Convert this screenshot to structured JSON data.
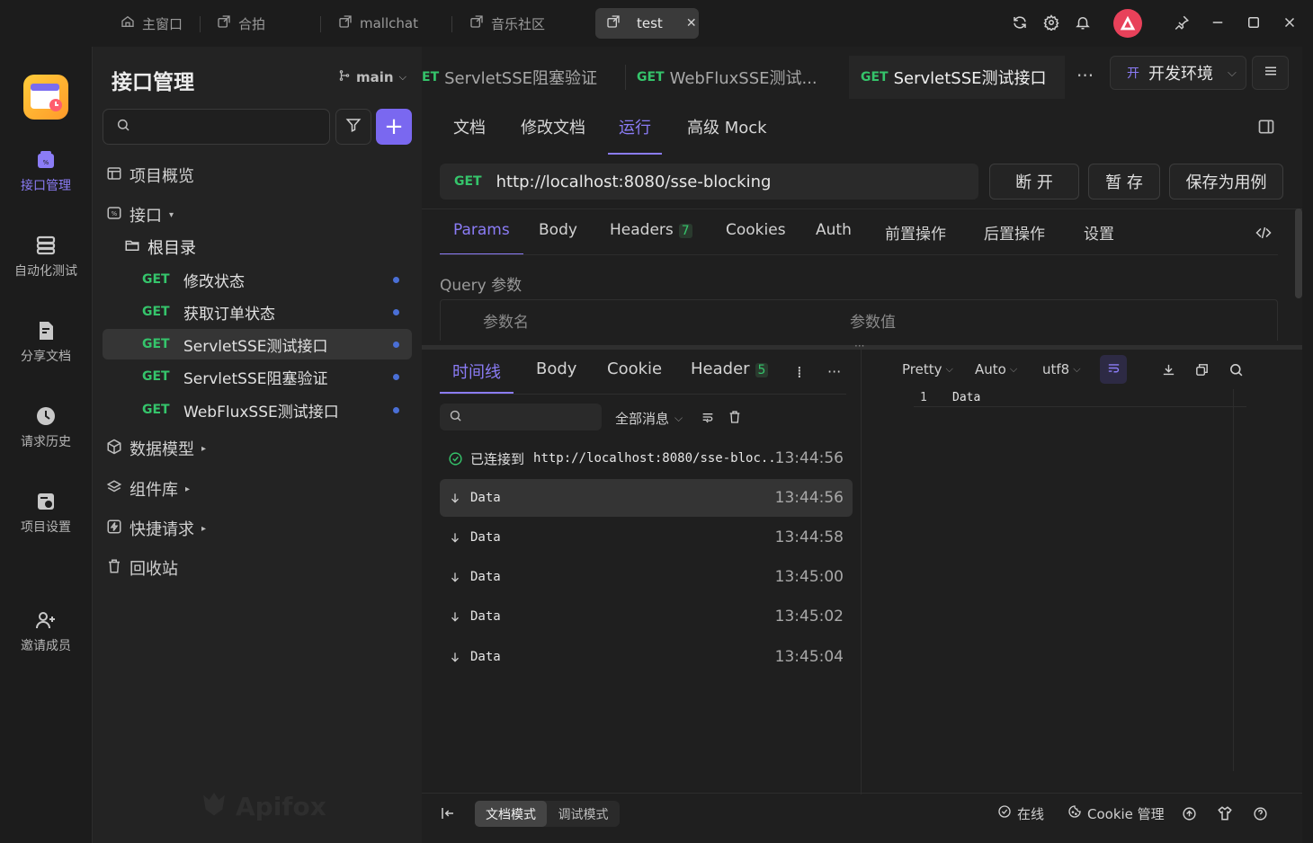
{
  "window_tabs": [
    {
      "label": "主窗口",
      "icon": "home-icon"
    },
    {
      "label": "合拍",
      "icon": "external-window-icon"
    },
    {
      "label": "mallchat",
      "icon": "external-window-icon"
    },
    {
      "label": "音乐社区",
      "icon": "external-window-icon"
    },
    {
      "label": "test",
      "icon": "external-window-icon",
      "active": true
    }
  ],
  "titlebar_icons": [
    "refresh-icon",
    "settings-icon",
    "bell-icon",
    "avatar",
    "pin-icon",
    "minimize-icon",
    "maximize-icon",
    "close-icon"
  ],
  "nav": [
    {
      "label": "接口管理",
      "icon": "api-management-icon",
      "active": true
    },
    {
      "label": "自动化测试",
      "icon": "automation-icon"
    },
    {
      "label": "分享文档",
      "icon": "share-doc-icon"
    },
    {
      "label": "请求历史",
      "icon": "history-icon"
    },
    {
      "label": "项目设置",
      "icon": "project-settings-icon"
    },
    {
      "label": "邀请成员",
      "icon": "invite-member-icon"
    }
  ],
  "sidebar": {
    "title": "接口管理",
    "branch": "main",
    "search_placeholder": "",
    "overview": "项目概览",
    "api_group": "接口",
    "root": "根目录",
    "apis": [
      {
        "method": "GET",
        "name": "修改状态"
      },
      {
        "method": "GET",
        "name": "获取订单状态"
      },
      {
        "method": "GET",
        "name": "ServletSSE测试接口",
        "selected": true
      },
      {
        "method": "GET",
        "name": "ServletSSE阻塞验证"
      },
      {
        "method": "GET",
        "name": "WebFluxSSE测试接口"
      }
    ],
    "sections": [
      {
        "label": "数据模型",
        "icon": "cube-icon"
      },
      {
        "label": "组件库",
        "icon": "layers-icon"
      },
      {
        "label": "快捷请求",
        "icon": "lightning-icon"
      },
      {
        "label": "回收站",
        "icon": "trash-icon"
      }
    ],
    "watermark": "Apifox"
  },
  "editor_tabs": [
    {
      "method": "GET",
      "name": "ServletSSE阻塞验证",
      "method_text": "ET"
    },
    {
      "method": "GET",
      "name": "WebFluxSSE测试..."
    },
    {
      "method": "GET",
      "name": "ServletSSE测试接口",
      "active": true
    }
  ],
  "env": {
    "badge": "开",
    "label": "开发环境"
  },
  "subtabs": [
    "文档",
    "修改文档",
    "运行",
    "高级 Mock"
  ],
  "active_subtab": "运行",
  "request": {
    "method": "GET",
    "url": "http://localhost:8080/sse-blocking"
  },
  "buttons": {
    "disconnect": "断 开",
    "save_temp": "暂 存",
    "save_case": "保存为用例"
  },
  "param_tabs": [
    {
      "label": "Params",
      "active": true
    },
    {
      "label": "Body"
    },
    {
      "label": "Headers",
      "count": "7"
    },
    {
      "label": "Cookies"
    },
    {
      "label": "Auth"
    },
    {
      "label": "前置操作"
    },
    {
      "label": "后置操作"
    },
    {
      "label": "设置"
    }
  ],
  "query": {
    "title": "Query 参数",
    "col_name": "参数名",
    "col_value": "参数值"
  },
  "response_tabs": [
    {
      "label": "时间线",
      "active": true
    },
    {
      "label": "Body"
    },
    {
      "label": "Cookie"
    },
    {
      "label": "Header",
      "count": "5"
    }
  ],
  "filter": {
    "all_messages": "全部消息"
  },
  "timeline": {
    "connected_label": "已连接到",
    "connected_url": "http://localhost:8080/sse-bloc...",
    "connected_time": "13:44:56",
    "messages": [
      {
        "label": "Data",
        "time": "13:44:56",
        "selected": true
      },
      {
        "label": "Data",
        "time": "13:44:58"
      },
      {
        "label": "Data",
        "time": "13:45:00"
      },
      {
        "label": "Data",
        "time": "13:45:02"
      },
      {
        "label": "Data",
        "time": "13:45:04"
      }
    ]
  },
  "viewer": {
    "format": "Pretty",
    "mode": "Auto",
    "encoding": "utf8",
    "line_no": "1",
    "content": "Data"
  },
  "footer": {
    "doc_mode": "文档模式",
    "debug_mode": "调试模式",
    "online": "在线",
    "cookie": "Cookie 管理"
  },
  "colors": {
    "accent": "#8b7cf6",
    "get": "#35c46b",
    "dot": "#4a6fd6"
  }
}
